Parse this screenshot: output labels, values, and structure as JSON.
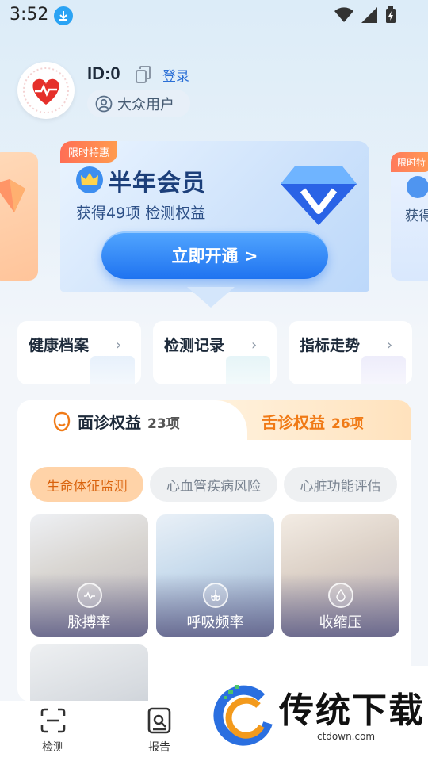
{
  "status_bar": {
    "time": "3:52"
  },
  "profile": {
    "id": "ID:0",
    "login": "登录",
    "user_type": "大众用户"
  },
  "member_card": {
    "tag": "限时特惠",
    "title": "半年会员",
    "desc": "获得49项 检测权益",
    "button": "立即开通 >"
  },
  "side_cards": {
    "right_tag": "限时特",
    "right_text": "获得"
  },
  "quick_entries": [
    {
      "label": "健康档案"
    },
    {
      "label": "检测记录"
    },
    {
      "label": "指标走势"
    }
  ],
  "tabs": {
    "face": {
      "label": "面诊权益",
      "count": "23项"
    },
    "tongue": {
      "label": "舌诊权益",
      "count": "26项"
    }
  },
  "chips": [
    "生命体征监测",
    "心血管疾病风险",
    "心脏功能评估"
  ],
  "metrics": [
    {
      "label": "脉搏率",
      "icon": "pulse-icon"
    },
    {
      "label": "呼吸频率",
      "icon": "lungs-icon"
    },
    {
      "label": "收缩压",
      "icon": "drop-icon"
    }
  ],
  "bottom_nav": [
    {
      "label": "检测",
      "icon": "scan-icon"
    },
    {
      "label": "报告",
      "icon": "report-icon"
    }
  ],
  "watermark": {
    "title": "传统下载",
    "url": "ctdown.com"
  },
  "colors": {
    "primary": "#1f73f0",
    "accent": "#f07a16",
    "chip_active": "#ffd3a8"
  }
}
